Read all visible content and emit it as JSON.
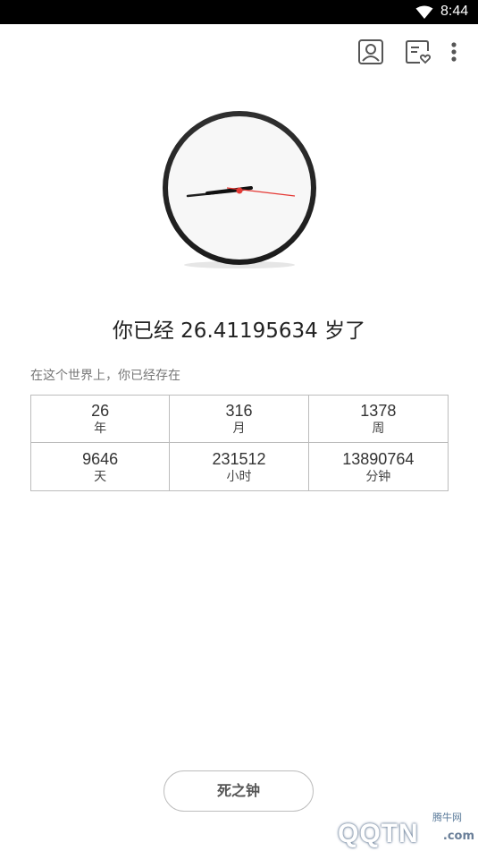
{
  "status_bar": {
    "time": "8:44",
    "wifi_icon": "wifi-icon"
  },
  "toolbar": {
    "icons": [
      "profile-icon",
      "favorites-list-icon",
      "more-vertical-icon"
    ]
  },
  "clock": {
    "hour_hand_color": "#111111",
    "second_hand_color": "#e53935",
    "rim_color": "#2a2a2a"
  },
  "age": {
    "prefix": "你已经",
    "value": "26.41195634",
    "suffix": "岁了"
  },
  "subtitle": "在这个世界上，你已经存在",
  "stats": [
    {
      "value": "26",
      "unit": "年"
    },
    {
      "value": "316",
      "unit": "月"
    },
    {
      "value": "1378",
      "unit": "周"
    },
    {
      "value": "9646",
      "unit": "天"
    },
    {
      "value": "231512",
      "unit": "小时"
    },
    {
      "value": "13890764",
      "unit": "分钟"
    }
  ],
  "death_clock_button": "死之钟",
  "watermark": {
    "top": "腾牛网",
    "main": "QQTN",
    "suffix": ".com"
  }
}
